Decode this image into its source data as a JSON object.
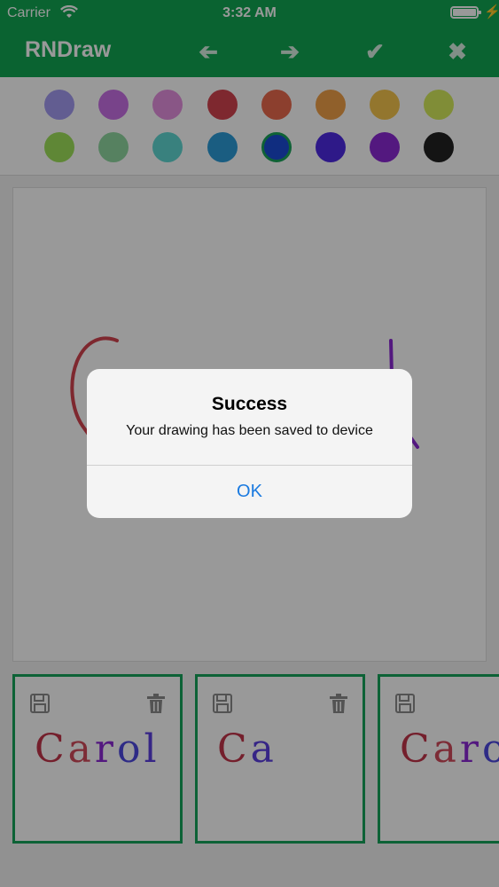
{
  "status": {
    "carrier": "Carrier",
    "time": "3:32 AM",
    "wifi_icon": "wifi-icon",
    "battery_icon": "battery-icon",
    "charging_icon": "bolt-icon"
  },
  "header": {
    "title": "RNDraw",
    "buttons": [
      {
        "name": "undo",
        "icon": "arrow-left-icon",
        "glyph": "➔"
      },
      {
        "name": "redo",
        "icon": "arrow-right-icon",
        "glyph": "➔"
      },
      {
        "name": "save",
        "icon": "check-icon",
        "glyph": "✔"
      },
      {
        "name": "clear",
        "icon": "close-icon",
        "glyph": "✖"
      }
    ]
  },
  "palette": {
    "colors": [
      "#a39bf2",
      "#c971e6",
      "#e58fe0",
      "#d2444f",
      "#e96a4e",
      "#f1a049",
      "#f5c54e",
      "#d6ec5d",
      "#9fe25a",
      "#8fd7a1",
      "#5fd8d2",
      "#2c9bd8",
      "#1c4bd5",
      "#4d2ae3",
      "#8b28d4",
      "#222222"
    ],
    "selected_index": 12
  },
  "canvas": {
    "stroke_colors": [
      "#d2444f",
      "#8b28d4"
    ]
  },
  "thumbnails": [
    {
      "text": "Carol",
      "letter_colors": [
        "#c2354a",
        "#d04a5a",
        "#8b28d4",
        "#4d48e0",
        "#5a3ee0"
      ]
    },
    {
      "text": "Ca",
      "letter_colors": [
        "#c2354a",
        "#5a3ee0"
      ]
    },
    {
      "text": "Carol",
      "letter_colors": [
        "#c2354a",
        "#d04a5a",
        "#8b28d4",
        "#4d48e0",
        "#5a3ee0"
      ]
    }
  ],
  "dialog": {
    "title": "Success",
    "message": "Your drawing has been saved to device",
    "ok_label": "OK"
  }
}
